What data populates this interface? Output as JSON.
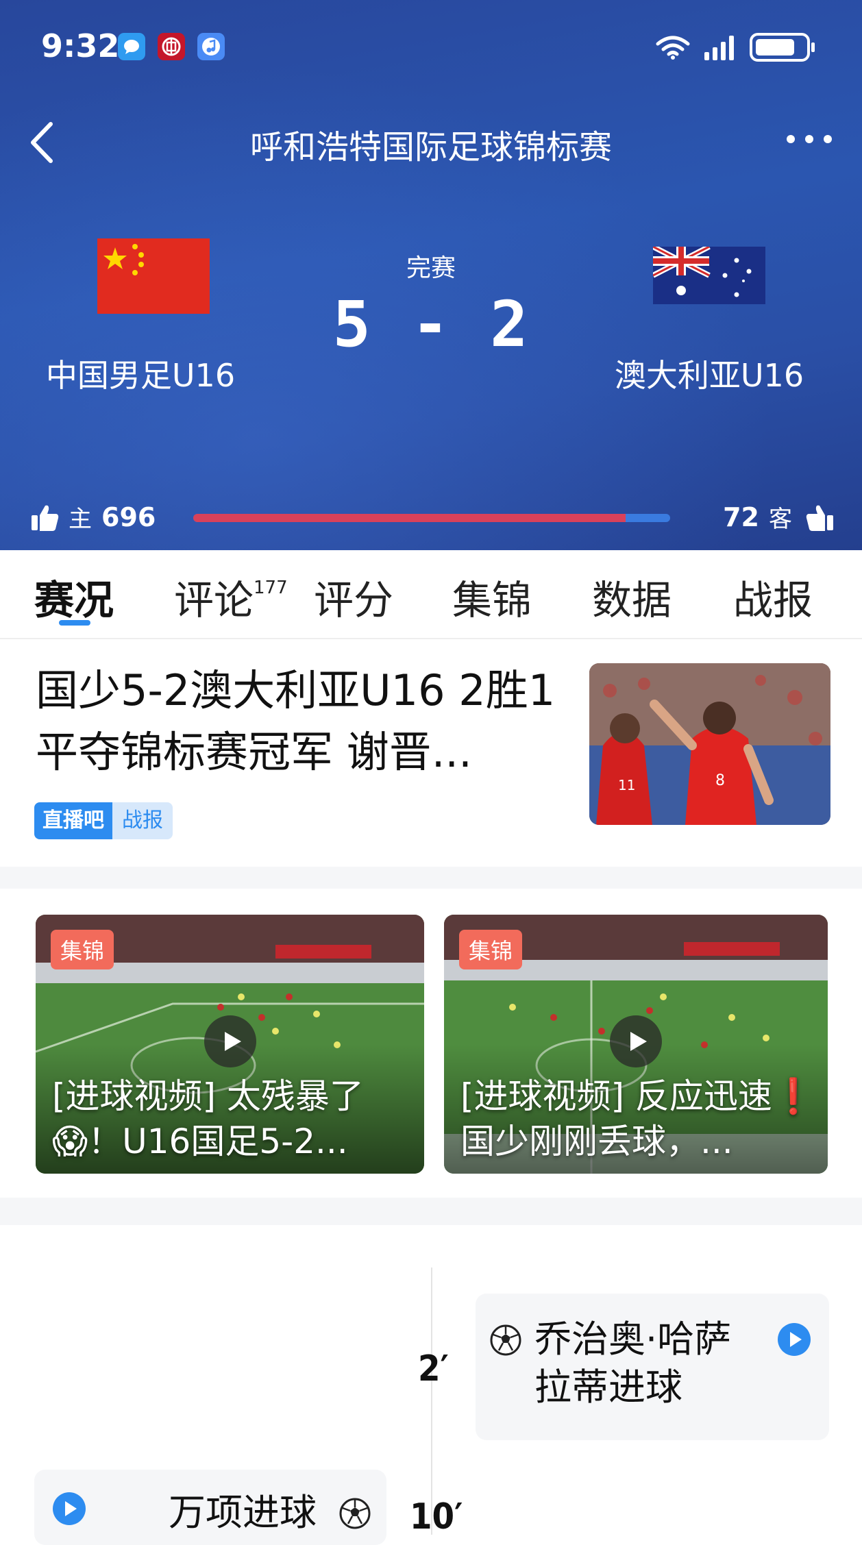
{
  "status_bar": {
    "time": "9:32",
    "icons_left": [
      "message-app-icon",
      "bank-app-icon",
      "music-app-icon"
    ],
    "icons_right": [
      "wifi-icon",
      "signal-icon",
      "battery-icon"
    ]
  },
  "header": {
    "title": "呼和浩特国际足球锦标赛",
    "back_icon": "back-icon",
    "more_icon": "more-icon"
  },
  "match": {
    "status": "完赛",
    "score": "5 - 2",
    "home": {
      "name": "中国男足U16",
      "flag": "china-flag"
    },
    "away": {
      "name": "澳大利亚U16",
      "flag": "australia-flag"
    }
  },
  "support": {
    "home_label": "主",
    "home_count": "696",
    "away_label": "客",
    "away_count": "72",
    "home_share": 0.906,
    "colors": {
      "home": "#d9415a",
      "away": "#3a7be0"
    }
  },
  "tabs": [
    {
      "label": "赛况",
      "active": true
    },
    {
      "label": "评论",
      "badge": "177"
    },
    {
      "label": "评分"
    },
    {
      "label": "集锦"
    },
    {
      "label": "数据"
    },
    {
      "label": "战报"
    }
  ],
  "news": {
    "title": "国少5-2澳大利亚U16 2胜1平夺锦标赛冠军 谢晋...",
    "source": "直播吧",
    "category": "战报"
  },
  "videos": [
    {
      "tag": "集锦",
      "caption": "[进球视频] 太残暴了😱！U16国足5-2..."
    },
    {
      "tag": "集锦",
      "caption": "[进球视频] 反应迅速❗国少刚刚丢球，..."
    }
  ],
  "timeline": [
    {
      "minute": "2′",
      "text": "乔治奥·哈萨拉蒂进球",
      "side": "away"
    },
    {
      "minute": "10′",
      "text": "万项进球",
      "side": "home"
    }
  ],
  "colors": {
    "accent": "#2d8cf0",
    "hero_bg": "#2a4fa6",
    "tag_bg": "#f26b5b"
  }
}
